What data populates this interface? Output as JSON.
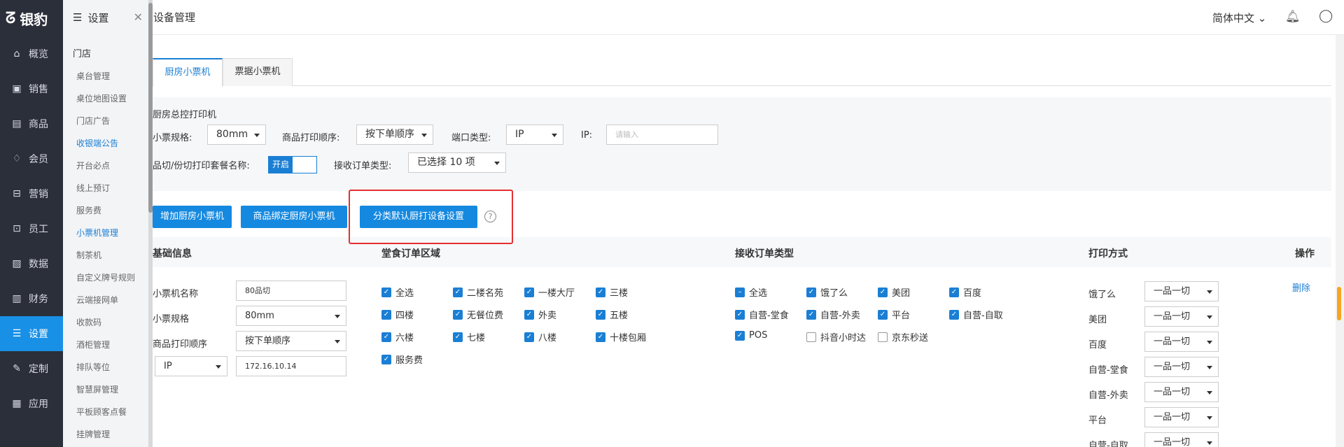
{
  "nav": {
    "logo": "银豹",
    "items": [
      {
        "label": "概览",
        "icon": "home-icon"
      },
      {
        "label": "销售",
        "icon": "sales-icon"
      },
      {
        "label": "商品",
        "icon": "goods-icon"
      },
      {
        "label": "会员",
        "icon": "member-icon"
      },
      {
        "label": "营销",
        "icon": "marketing-icon"
      },
      {
        "label": "员工",
        "icon": "staff-icon"
      },
      {
        "label": "数据",
        "icon": "data-icon"
      },
      {
        "label": "财务",
        "icon": "finance-icon"
      },
      {
        "label": "设置",
        "icon": "settings-icon",
        "active": true
      },
      {
        "label": "定制",
        "icon": "custom-icon"
      },
      {
        "label": "应用",
        "icon": "apps-icon"
      }
    ]
  },
  "submenu": {
    "title": "设置",
    "section": "门店",
    "items": [
      "桌台管理",
      "桌位地图设置",
      "门店广告",
      "收银端公告",
      "开台必点",
      "线上预订",
      "服务费",
      "小票机管理",
      "制茶机",
      "自定义牌号规则",
      "云端接网单",
      "收款码",
      "酒柜管理",
      "排队等位",
      "智慧屏管理",
      "平板顾客点餐",
      "挂牌管理"
    ]
  },
  "header": {
    "title": "设备管理",
    "lang": "简体中文"
  },
  "tabs": [
    "厨房小票机",
    "票据小票机"
  ],
  "config": {
    "section_title": "厨房总控打印机",
    "ticket_spec_label": "小票规格:",
    "ticket_spec_value": "80mm",
    "print_order_label": "商品打印顺序:",
    "print_order_value": "按下单顺序",
    "port_type_label": "端口类型:",
    "port_type_value": "IP",
    "ip_label": "IP:",
    "ip_placeholder": "请输入",
    "combo_label": "品切/份切打印套餐名称:",
    "combo_toggle": "开启",
    "order_type_label": "接收订单类型:",
    "order_type_value": "已选择 10 项"
  },
  "buttons": {
    "add": "增加厨房小票机",
    "bind": "商品绑定厨房小票机",
    "category": "分类默认厨打设备设置"
  },
  "table": {
    "headers": [
      "基础信息",
      "堂食订单区域",
      "接收订单类型",
      "打印方式",
      "操作"
    ],
    "row": {
      "name_label": "小票机名称",
      "name_value": "80品切",
      "spec_label": "小票规格",
      "spec_value": "80mm",
      "order_label": "商品打印顺序",
      "order_value": "按下单顺序",
      "port_value": "IP",
      "ip_value": "172.16.10.14",
      "areas": [
        {
          "label": "全选",
          "checked": true
        },
        {
          "label": "二楼名苑",
          "checked": true
        },
        {
          "label": "一楼大厅",
          "checked": true
        },
        {
          "label": "三楼",
          "checked": true
        },
        {
          "label": "四楼",
          "checked": true
        },
        {
          "label": "无餐位费",
          "checked": true
        },
        {
          "label": "外卖",
          "checked": true
        },
        {
          "label": "五楼",
          "checked": true
        },
        {
          "label": "六楼",
          "checked": true
        },
        {
          "label": "七楼",
          "checked": true
        },
        {
          "label": "八楼",
          "checked": true
        },
        {
          "label": "十楼包厢",
          "checked": true
        },
        {
          "label": "服务费",
          "checked": true
        }
      ],
      "order_types": [
        {
          "label": "全选",
          "checked": "partial"
        },
        {
          "label": "饿了么",
          "checked": true
        },
        {
          "label": "美团",
          "checked": true
        },
        {
          "label": "百度",
          "checked": true
        },
        {
          "label": "自营-堂食",
          "checked": true
        },
        {
          "label": "自营-外卖",
          "checked": true
        },
        {
          "label": "平台",
          "checked": true
        },
        {
          "label": "自营-自取",
          "checked": true
        },
        {
          "label": "POS",
          "checked": true
        },
        {
          "label": "抖音小时达",
          "checked": false
        },
        {
          "label": "京东秒送",
          "checked": false
        }
      ],
      "print_modes": [
        {
          "label": "饿了么",
          "value": "一品一切"
        },
        {
          "label": "美团",
          "value": "一品一切"
        },
        {
          "label": "百度",
          "value": "一品一切"
        },
        {
          "label": "自营-堂食",
          "value": "一品一切"
        },
        {
          "label": "自营-外卖",
          "value": "一品一切"
        },
        {
          "label": "平台",
          "value": "一品一切"
        },
        {
          "label": "自营-自取",
          "value": "一品一切"
        }
      ],
      "action": "删除"
    }
  }
}
